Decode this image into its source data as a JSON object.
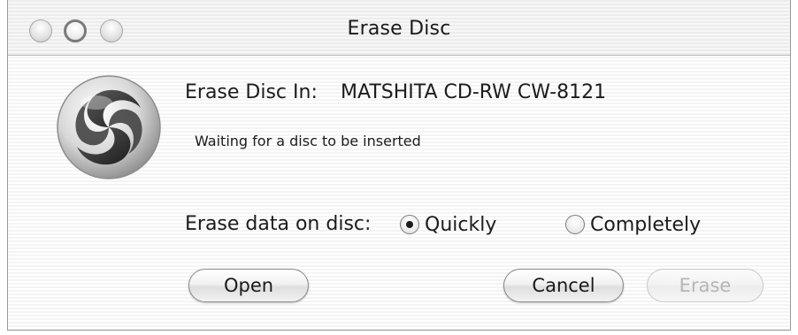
{
  "window": {
    "title": "Erase Disc"
  },
  "icons": {
    "app": "disc-utility-swirl-icon",
    "close": "close-button-icon",
    "minimize": "minimize-button-icon",
    "zoom": "zoom-button-icon",
    "radio_checked": "radio-checked-icon",
    "radio_unchecked": "radio-unchecked-icon"
  },
  "drive": {
    "label": "Erase Disc In:",
    "device": "MATSHITA CD-RW CW-8121"
  },
  "status": "Waiting for a disc to be inserted",
  "erase_options": {
    "label": "Erase data on disc:",
    "quickly": "Quickly",
    "completely": "Completely",
    "selected": "Quickly"
  },
  "buttons": {
    "open": "Open",
    "cancel": "Cancel",
    "erase": "Erase",
    "erase_enabled": false
  }
}
